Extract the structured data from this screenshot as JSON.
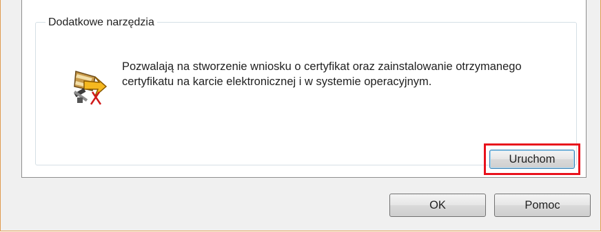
{
  "group": {
    "title": "Dodatkowe narzędzia",
    "description": "Pozwalają na stworzenie wniosku o certyfikat oraz zainstalowanie otrzymanego certyfikatu na karcie elektronicznej i w systemie operacyjnym.",
    "icon": "tools-wizard-icon",
    "run_label": "Uruchom",
    "highlight_color": "#e8101b"
  },
  "footer": {
    "ok_label": "OK",
    "help_label": "Pomoc"
  }
}
